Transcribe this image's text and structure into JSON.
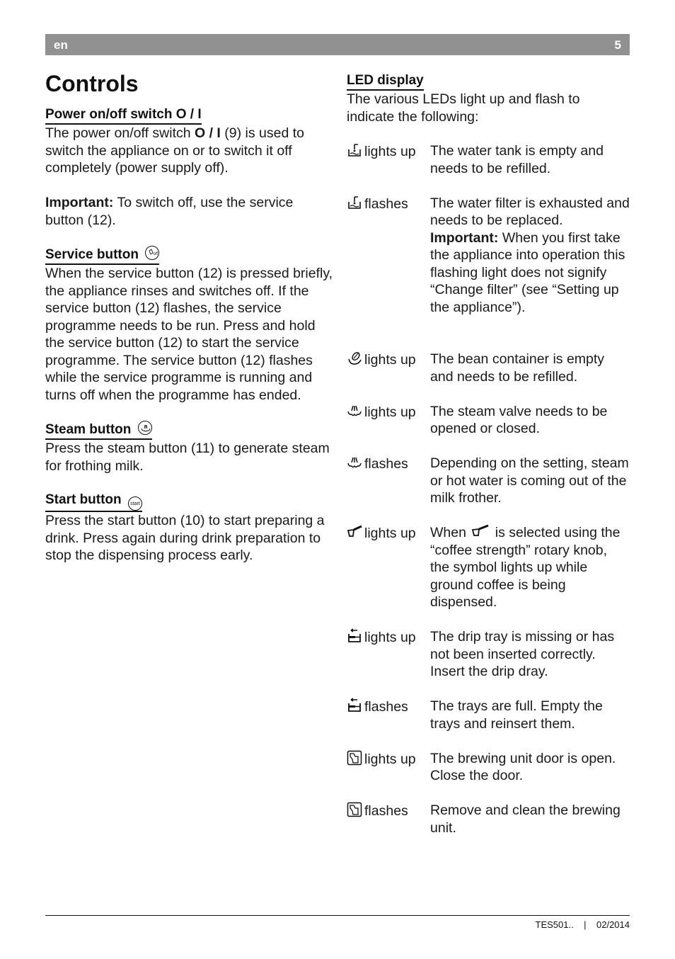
{
  "header": {
    "language": "en",
    "page_number": "5"
  },
  "page_title": "Controls",
  "left_sections": [
    {
      "heading": "Power on/off switch O / I",
      "paragraphs": [
        {
          "before": "The power on/off switch ",
          "bold": "O / I",
          "after": " (9) is used to switch the appliance on or to switch it off completely (power supply off)."
        },
        {
          "bold": "Important:",
          "after": " To switch off, use the service button (12)."
        }
      ]
    },
    {
      "heading": "Service button",
      "icon": "service-off-icon",
      "icon_text": "off",
      "text": "When the service button (12) is pressed briefly, the appliance rinses and switches off. If the service button (12) flashes, the service programme needs to be run. Press and hold the service button (12) to start the service programme. The service button (12) flashes while the service programme is running and turns off when the programme has ended."
    },
    {
      "heading": "Steam button",
      "icon": "steam-icon",
      "text": "Press the steam button (11) to generate steam for frothing milk."
    },
    {
      "heading": "Start button",
      "icon": "start-icon",
      "icon_text": "start",
      "text": "Press the start button (10) to start preparing a drink. Press again during drink preparation to stop the dispensing process early."
    }
  ],
  "led_display": {
    "heading": "LED display",
    "intro": "The various LEDs light up and flash to indicate the following:",
    "rows": [
      {
        "icon": "water-tank-icon",
        "state": "lights up",
        "description": "The water tank is empty and needs to be refilled."
      },
      {
        "icon": "water-tank-icon",
        "state": "flashes",
        "description": "The water filter is exhausted and needs to be replaced.",
        "important_label": "Important:",
        "important_text": " When you first take the appliance into operation this flashing light does not signify “Change filter” (see “Setting up the appliance”)."
      },
      {
        "icon": "bean-container-icon",
        "state": "lights up",
        "description": "The bean container is empty and needs to be refilled."
      },
      {
        "icon": "steam-valve-icon",
        "state": "lights up",
        "description": "The steam valve needs to be opened or closed."
      },
      {
        "icon": "steam-valve-icon",
        "state": "flashes",
        "description": "Depending on the setting, steam or hot water is coming out of the milk frother."
      },
      {
        "icon": "ground-coffee-icon",
        "state": "lights up",
        "description_before": "When ",
        "description_after": " is selected using the “coffee strength” rotary knob, the symbol lights up while ground coffee is being dispensed."
      },
      {
        "icon": "drip-tray-icon",
        "state": "lights up",
        "description": "The drip tray is missing or has not been inserted correctly. Insert the drip dray."
      },
      {
        "icon": "drip-tray-icon",
        "state": "flashes",
        "description": "The trays are full. Empty the trays and reinsert them."
      },
      {
        "icon": "brewing-unit-door-icon",
        "state": "lights up",
        "description": "The brewing unit door is open. Close the door."
      },
      {
        "icon": "brewing-unit-door-icon",
        "state": "flashes",
        "description": "Remove and clean the brewing unit."
      }
    ]
  },
  "footer": {
    "model": "TES501..",
    "separator": "|",
    "date": "02/2014"
  }
}
